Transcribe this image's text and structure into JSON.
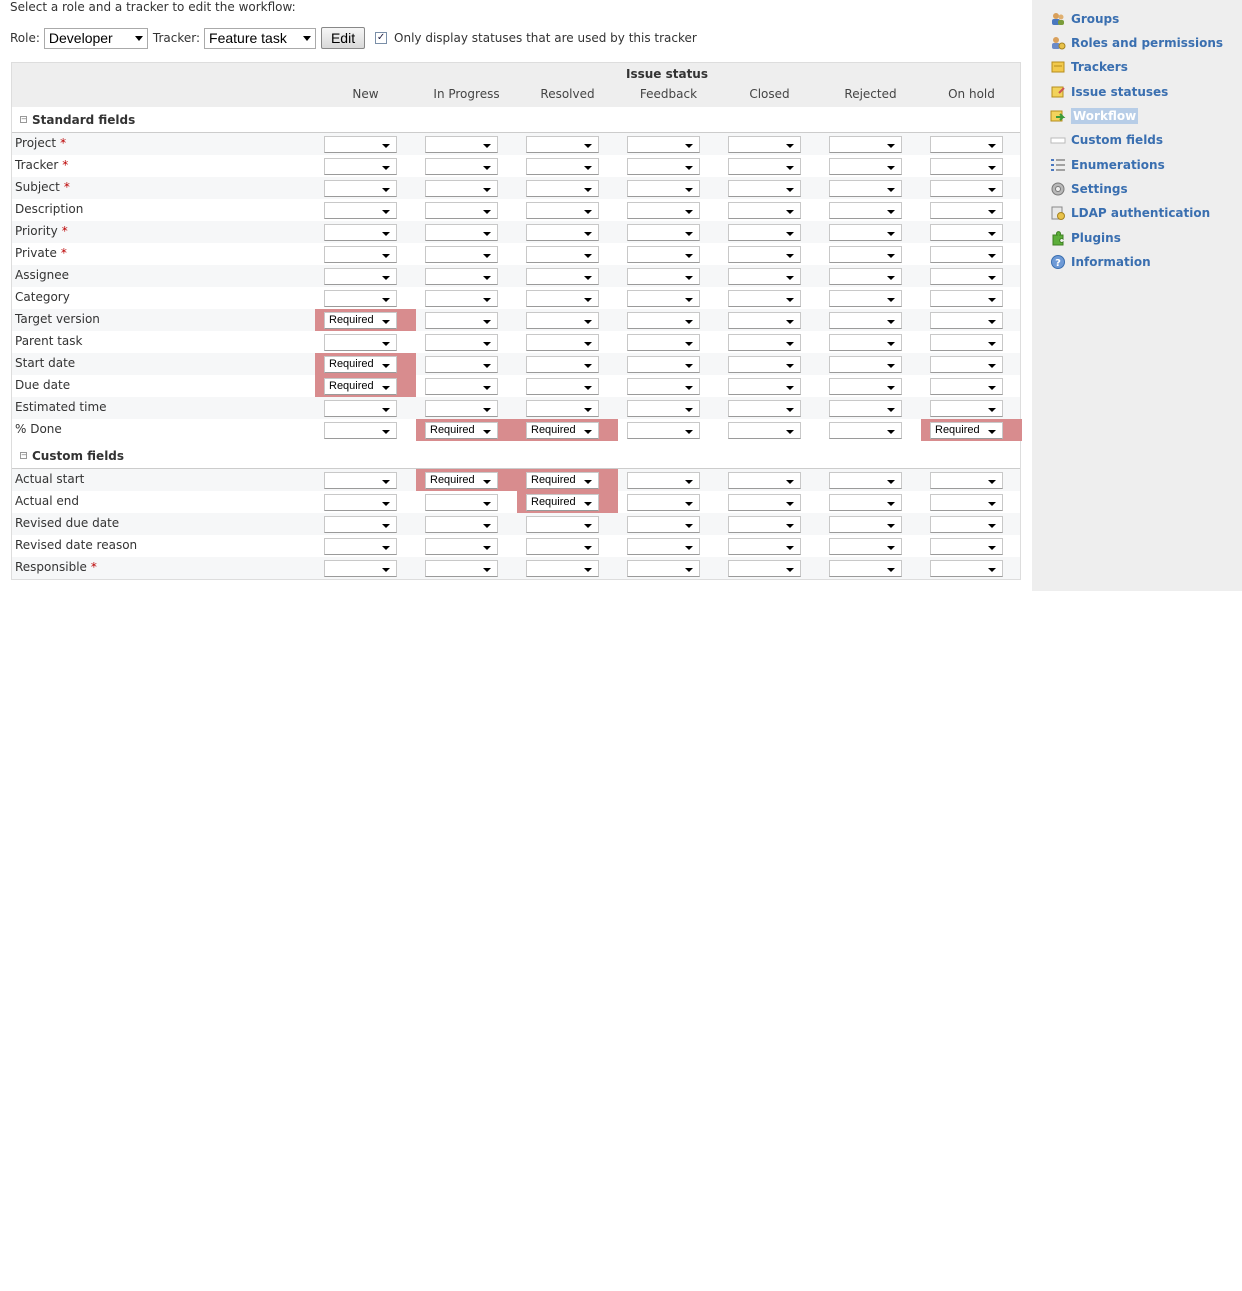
{
  "intro_text": "Select a role and a tracker to edit the workflow:",
  "controls": {
    "role_label": "Role:",
    "role_value": "Developer",
    "tracker_label": "Tracker:",
    "tracker_value": "Feature task",
    "edit_label": "Edit",
    "only_statuses_checked": true,
    "only_statuses_label": "Only display statuses that are used by this tracker"
  },
  "table": {
    "issue_status_label": "Issue status",
    "statuses": [
      "New",
      "In Progress",
      "Resolved",
      "Feedback",
      "Closed",
      "Rejected",
      "On hold"
    ],
    "groups": [
      {
        "title": "Standard fields",
        "rows": [
          {
            "label": "Project",
            "required": true,
            "cells": [
              "",
              "",
              "",
              "",
              "",
              "",
              ""
            ]
          },
          {
            "label": "Tracker",
            "required": true,
            "cells": [
              "",
              "",
              "",
              "",
              "",
              "",
              ""
            ]
          },
          {
            "label": "Subject",
            "required": true,
            "cells": [
              "",
              "",
              "",
              "",
              "",
              "",
              ""
            ]
          },
          {
            "label": "Description",
            "required": false,
            "cells": [
              "",
              "",
              "",
              "",
              "",
              "",
              ""
            ]
          },
          {
            "label": "Priority",
            "required": true,
            "cells": [
              "",
              "",
              "",
              "",
              "",
              "",
              ""
            ]
          },
          {
            "label": "Private",
            "required": true,
            "cells": [
              "",
              "",
              "",
              "",
              "",
              "",
              ""
            ]
          },
          {
            "label": "Assignee",
            "required": false,
            "cells": [
              "",
              "",
              "",
              "",
              "",
              "",
              ""
            ]
          },
          {
            "label": "Category",
            "required": false,
            "cells": [
              "",
              "",
              "",
              "",
              "",
              "",
              ""
            ]
          },
          {
            "label": "Target version",
            "required": false,
            "cells": [
              "Required",
              "",
              "",
              "",
              "",
              "",
              ""
            ]
          },
          {
            "label": "Parent task",
            "required": false,
            "cells": [
              "",
              "",
              "",
              "",
              "",
              "",
              ""
            ]
          },
          {
            "label": "Start date",
            "required": false,
            "cells": [
              "Required",
              "",
              "",
              "",
              "",
              "",
              ""
            ]
          },
          {
            "label": "Due date",
            "required": false,
            "cells": [
              "Required",
              "",
              "",
              "",
              "",
              "",
              ""
            ]
          },
          {
            "label": "Estimated time",
            "required": false,
            "cells": [
              "",
              "",
              "",
              "",
              "",
              "",
              ""
            ]
          },
          {
            "label": "% Done",
            "required": false,
            "cells": [
              "",
              "Required",
              "Required",
              "",
              "",
              "",
              "Required"
            ]
          }
        ]
      },
      {
        "title": "Custom fields",
        "rows": [
          {
            "label": "Actual start",
            "required": false,
            "cells": [
              "",
              "Required",
              "Required",
              "",
              "",
              "",
              ""
            ]
          },
          {
            "label": "Actual end",
            "required": false,
            "cells": [
              "",
              "",
              "Required",
              "",
              "",
              "",
              ""
            ]
          },
          {
            "label": "Revised due date",
            "required": false,
            "cells": [
              "",
              "",
              "",
              "",
              "",
              "",
              ""
            ]
          },
          {
            "label": "Revised date reason",
            "required": false,
            "cells": [
              "",
              "",
              "",
              "",
              "",
              "",
              ""
            ]
          },
          {
            "label": "Responsible",
            "required": true,
            "cells": [
              "",
              "",
              "",
              "",
              "",
              "",
              ""
            ]
          }
        ]
      }
    ],
    "required_star": "*",
    "required_color": "#d88c8e"
  },
  "sidebar": {
    "items": [
      {
        "label": "Groups",
        "icon": "groups-icon",
        "active": false
      },
      {
        "label": "Roles and permissions",
        "icon": "roles-icon",
        "active": false
      },
      {
        "label": "Trackers",
        "icon": "trackers-icon",
        "active": false
      },
      {
        "label": "Issue statuses",
        "icon": "issue-statuses-icon",
        "active": false
      },
      {
        "label": "Workflow",
        "icon": "workflow-icon",
        "active": true
      },
      {
        "label": "Custom fields",
        "icon": "custom-fields-icon",
        "active": false
      },
      {
        "label": "Enumerations",
        "icon": "enumerations-icon",
        "active": false
      },
      {
        "label": "Settings",
        "icon": "settings-icon",
        "active": false
      },
      {
        "label": "LDAP authentication",
        "icon": "ldap-icon",
        "active": false
      },
      {
        "label": "Plugins",
        "icon": "plugins-icon",
        "active": false
      },
      {
        "label": "Information",
        "icon": "information-icon",
        "active": false
      }
    ],
    "link_color": "#3a6fb0"
  }
}
